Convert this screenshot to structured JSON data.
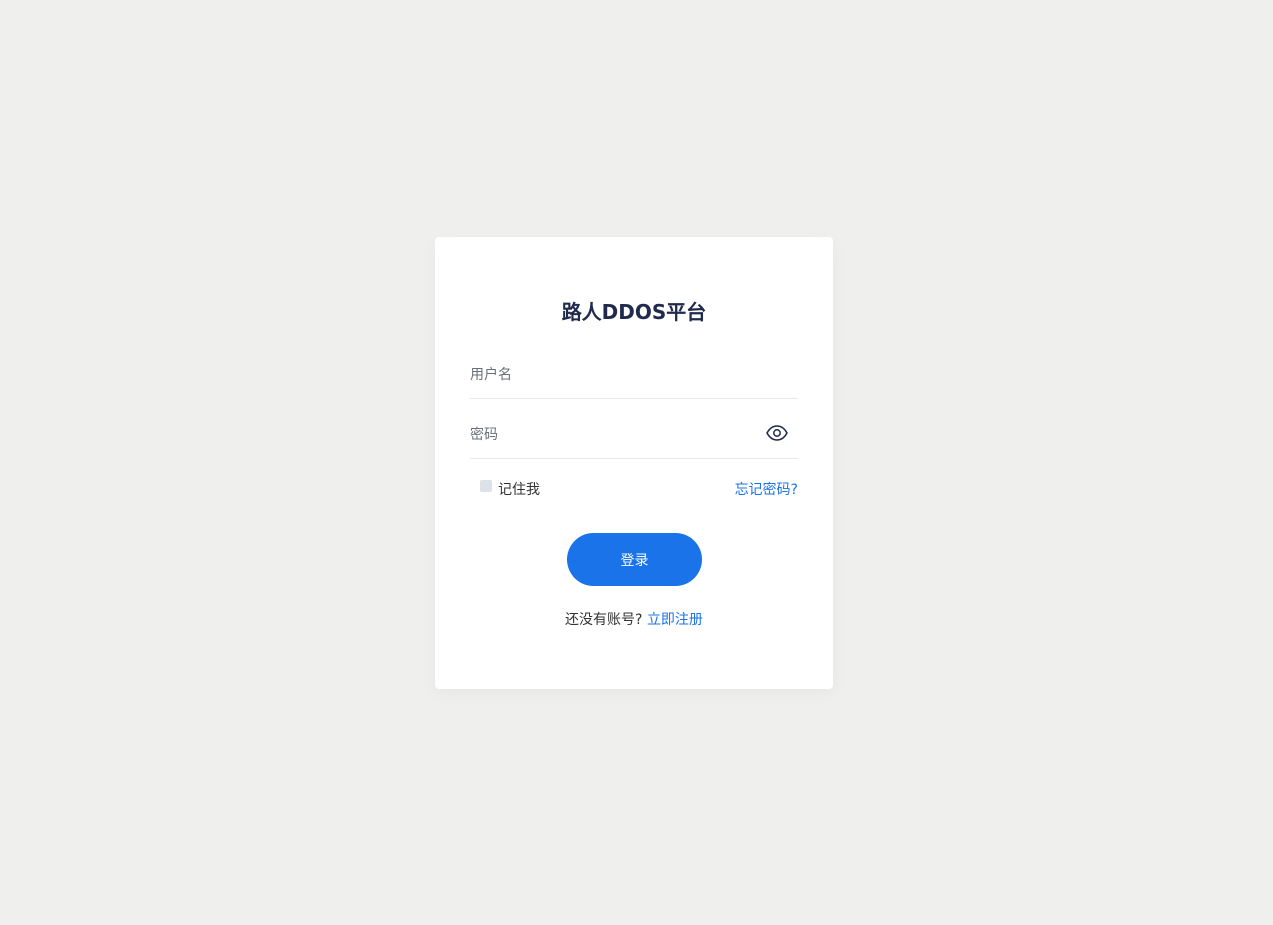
{
  "page": {
    "title": "路人DDOS平台",
    "background": "#efefed"
  },
  "form": {
    "username_placeholder": "用户名",
    "username_value": "",
    "password_placeholder": "密码",
    "password_value": "",
    "toggle_icon": "eye-icon",
    "remember_label": "记住我",
    "remember_checked": false,
    "forgot_label": "忘记密码?",
    "login_label": "登录",
    "no_account_text": "还没有账号?",
    "register_label": "立即注册"
  },
  "colors": {
    "accent": "#1a73e8",
    "title": "#1f2a4d",
    "card": "#ffffff"
  }
}
